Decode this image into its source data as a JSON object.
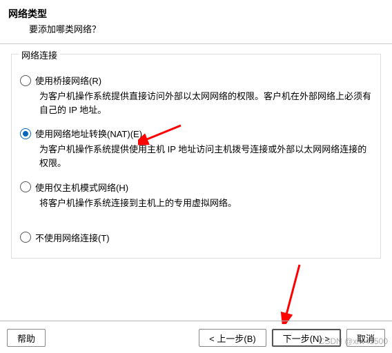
{
  "header": {
    "title": "网络类型",
    "subtitle": "要添加哪类网络？"
  },
  "group": {
    "legend": "网络连接"
  },
  "options": [
    {
      "label": "使用桥接网络(R)",
      "desc": "为客户机操作系统提供直接访问外部以太网网络的权限。客户机在外部网络上必须有自己的 IP 地址。",
      "selected": false
    },
    {
      "label": "使用网络地址转换(NAT)(E)",
      "desc": "为客户机操作系统提供使用主机 IP 地址访问主机拨号连接或外部以太网网络连接的权限。",
      "selected": true
    },
    {
      "label": "使用仅主机模式网络(H)",
      "desc": "将客户机操作系统连接到主机上的专用虚拟网络。",
      "selected": false
    },
    {
      "label": "不使用网络连接(T)",
      "desc": "",
      "selected": false
    }
  ],
  "buttons": {
    "help": "帮助",
    "back": "< 上一步(B)",
    "next": "下一步(N) >",
    "cancel": "取消"
  },
  "watermark": "CSDN @xlw41500"
}
